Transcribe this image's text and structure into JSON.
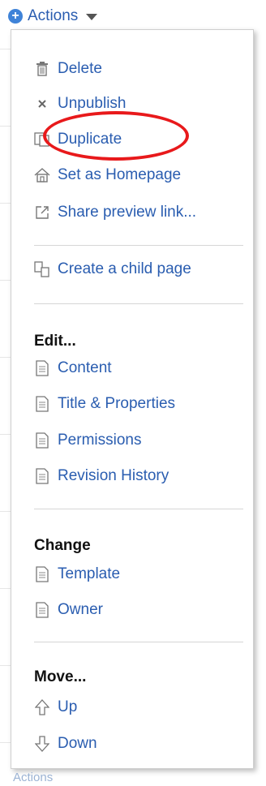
{
  "trigger": {
    "label": "Actions"
  },
  "menu": {
    "primary": [
      {
        "label": "Delete",
        "icon": "trash-icon"
      },
      {
        "label": "Unpublish",
        "icon": "x-icon"
      },
      {
        "label": "Duplicate",
        "icon": "duplicate-icon"
      },
      {
        "label": "Set as Homepage",
        "icon": "home-icon"
      },
      {
        "label": "Share preview link...",
        "icon": "share-link-icon"
      }
    ],
    "child": {
      "label": "Create a child page",
      "icon": "child-page-icon"
    },
    "edit": {
      "heading": "Edit...",
      "items": [
        {
          "label": "Content",
          "icon": "page-icon"
        },
        {
          "label": "Title & Properties",
          "icon": "page-icon"
        },
        {
          "label": "Permissions",
          "icon": "page-icon"
        },
        {
          "label": "Revision History",
          "icon": "page-icon"
        }
      ]
    },
    "change": {
      "heading": "Change",
      "items": [
        {
          "label": "Template",
          "icon": "page-icon"
        },
        {
          "label": "Owner",
          "icon": "page-icon"
        }
      ]
    },
    "move": {
      "heading": "Move...",
      "items": [
        {
          "label": "Up",
          "icon": "arrow-up-icon"
        },
        {
          "label": "Down",
          "icon": "arrow-down-icon"
        }
      ]
    }
  },
  "bottom_ghost": {
    "label": "Actions"
  },
  "colors": {
    "link": "#2a5db0",
    "annotation": "#e8191b",
    "plus_badge": "#3f83d8"
  }
}
